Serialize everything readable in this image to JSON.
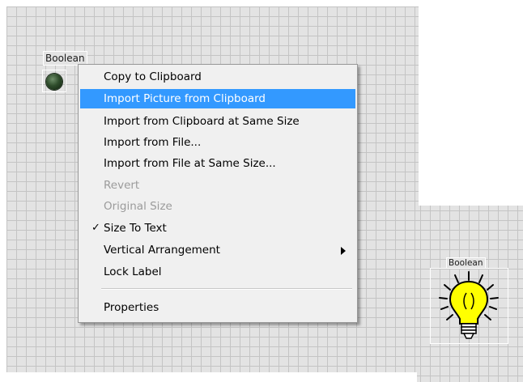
{
  "front_panel": {
    "boolean_led": {
      "label": "Boolean"
    },
    "boolean_bulb": {
      "label": "Boolean"
    }
  },
  "context_menu": {
    "items": [
      {
        "label": "Copy to Clipboard",
        "enabled": true,
        "selected": false,
        "checked": false,
        "submenu": false
      },
      {
        "label": "Import Picture from Clipboard",
        "enabled": true,
        "selected": true,
        "checked": false,
        "submenu": false
      },
      {
        "label": "Import from Clipboard at Same Size",
        "enabled": true,
        "selected": false,
        "checked": false,
        "submenu": false
      },
      {
        "label": "Import from File...",
        "enabled": true,
        "selected": false,
        "checked": false,
        "submenu": false
      },
      {
        "label": "Import from File at Same Size...",
        "enabled": true,
        "selected": false,
        "checked": false,
        "submenu": false
      },
      {
        "label": "Revert",
        "enabled": false,
        "selected": false,
        "checked": false,
        "submenu": false
      },
      {
        "label": "Original Size",
        "enabled": false,
        "selected": false,
        "checked": false,
        "submenu": false
      },
      {
        "label": "Size To Text",
        "enabled": true,
        "selected": false,
        "checked": true,
        "submenu": false
      },
      {
        "label": "Vertical Arrangement",
        "enabled": true,
        "selected": false,
        "checked": false,
        "submenu": true
      },
      {
        "label": "Lock Label",
        "enabled": true,
        "selected": false,
        "checked": false,
        "submenu": false
      },
      {
        "label": "Properties",
        "enabled": true,
        "selected": false,
        "checked": false,
        "submenu": false
      }
    ],
    "check_glyph": "✓"
  },
  "colors": {
    "grid_bg": "#e3e3e3",
    "grid_line": "#c4c4c4",
    "menu_bg": "#f0f0f0",
    "selection": "#3399ff",
    "disabled_text": "#9b9b9b",
    "bulb_yellow": "#ffff00",
    "led_green": "#2f4d2c"
  }
}
